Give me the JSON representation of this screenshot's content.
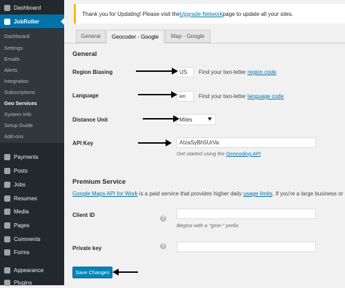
{
  "sidebar": {
    "top": [
      {
        "label": "Dashboard",
        "icon": "dashboard-icon"
      },
      {
        "label": "JobRoller",
        "icon": "jobroller-icon"
      }
    ],
    "sub": [
      "Dashboard",
      "Settings",
      "Emails",
      "Alerts",
      "Integration",
      "Subscriptions",
      "Geo Services",
      "System Info",
      "Setup Guide",
      "Add-ons"
    ],
    "current_sub": "Geo Services",
    "bottom": [
      {
        "label": "Payments",
        "icon": "payments-icon"
      },
      {
        "label": "Posts",
        "icon": "pin-icon"
      },
      {
        "label": "Jobs",
        "icon": "jobs-icon"
      },
      {
        "label": "Resumes",
        "icon": "resumes-icon"
      },
      {
        "label": "Media",
        "icon": "media-icon"
      },
      {
        "label": "Pages",
        "icon": "pages-icon"
      },
      {
        "label": "Comments",
        "icon": "comments-icon"
      },
      {
        "label": "Forms",
        "icon": "forms-icon"
      },
      {
        "label": "Appearance",
        "icon": "appearance-icon"
      },
      {
        "label": "Plugins",
        "icon": "plugins-icon"
      }
    ]
  },
  "notice": {
    "before": "Thank you for Updating! Please visit the ",
    "link": "Upgrade Network",
    "after": " page to update all your sites."
  },
  "tabs": [
    "General",
    "Geocoder - Google",
    "Map - Google"
  ],
  "active_tab": "Geocoder - Google",
  "general": {
    "heading": "General",
    "region": {
      "label": "Region Biasing",
      "value": "US",
      "desc_before": "Find your two-letter ",
      "desc_link": "region code"
    },
    "language": {
      "label": "Language",
      "value": "en",
      "desc_before": "Find your two-letter ",
      "desc_link": "language code"
    },
    "distance": {
      "label": "Distance Unit",
      "value": "Miles"
    },
    "apikey": {
      "label": "API Key",
      "value": "AIzaSyBh5UrVa",
      "desc_before": "Get started using the ",
      "desc_link": "Geocoding API"
    }
  },
  "premium": {
    "heading": "Premium Service",
    "intro_link1": "Google Maps API for Work",
    "intro_mid": " is a paid service that provides higher daily ",
    "intro_link2": "usage limits",
    "intro_after": ". If you're a large business or max out",
    "client": {
      "label": "Client ID",
      "value": "",
      "hint": "Begins with a \"gme-\" prefix"
    },
    "private": {
      "label": "Private key",
      "value": ""
    }
  },
  "save_label": "Save Changes",
  "colors": {
    "accent": "#0073aa",
    "sidebar": "#23282d",
    "notice": "#ffb900",
    "button": "#0085ba"
  }
}
